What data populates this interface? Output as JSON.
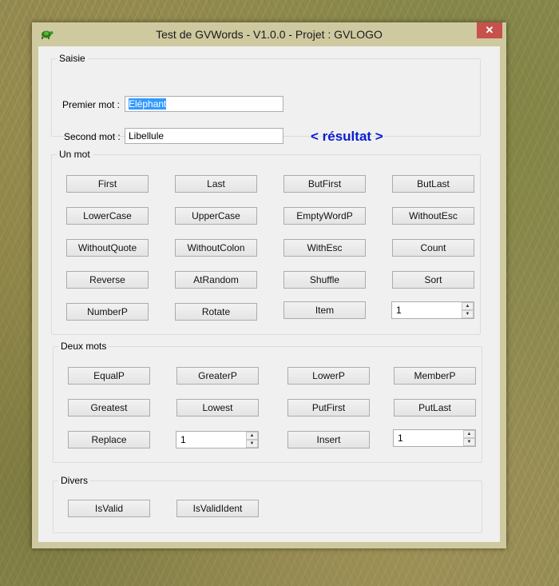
{
  "window": {
    "title": "Test de GVWords - V1.0.0 - Projet : GVLOGO",
    "close": "✕"
  },
  "saisie": {
    "legend": "Saisie",
    "first_label": "Premier mot :",
    "first_value": "Eléphant",
    "second_label": "Second mot :",
    "second_value": "Libellule",
    "result": "< résultat >"
  },
  "un_mot": {
    "legend": "Un mot",
    "buttons": [
      "First",
      "Last",
      "ButFirst",
      "ButLast",
      "LowerCase",
      "UpperCase",
      "EmptyWordP",
      "WithoutEsc",
      "WithoutQuote",
      "WithoutColon",
      "WithEsc",
      "Count",
      "Reverse",
      "AtRandom",
      "Shuffle",
      "Sort",
      "NumberP",
      "Rotate",
      "Item"
    ],
    "item_spin": "1"
  },
  "deux_mots": {
    "legend": "Deux mots",
    "buttons": [
      "EqualP",
      "GreaterP",
      "LowerP",
      "MemberP",
      "Greatest",
      "Lowest",
      "PutFirst",
      "PutLast",
      "Replace",
      "Insert"
    ],
    "replace_spin": "1",
    "insert_spin": "1"
  },
  "divers": {
    "legend": "Divers",
    "buttons": [
      "IsValid",
      "IsValidIdent"
    ]
  },
  "icons": {
    "spin_up": "▲",
    "spin_down": "▼"
  }
}
